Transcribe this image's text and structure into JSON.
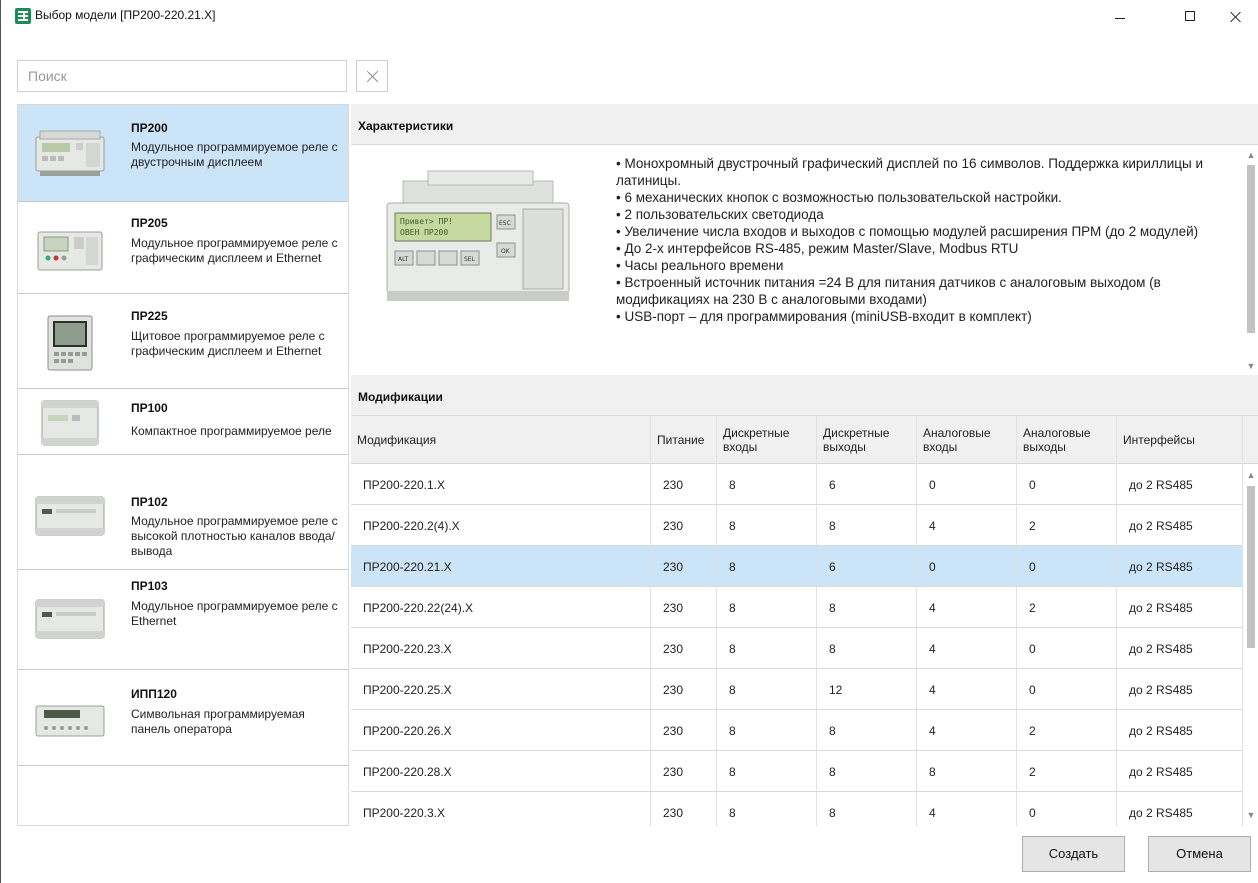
{
  "window": {
    "title": "Выбор модели [ПР200-220.21.X]"
  },
  "search": {
    "placeholder": "Поиск",
    "value": ""
  },
  "models": [
    {
      "name": "ПР200",
      "description": "Модульное программируемое реле с двустрочным дисплеем",
      "selected": true
    },
    {
      "name": "ПР205",
      "description": "Модульное программируемое реле с графическим дисплеем  и Ethernet",
      "selected": false
    },
    {
      "name": "ПР225",
      "description": "Щитовое программируемое реле с графическим дисплеем  и Ethernet",
      "selected": false
    },
    {
      "name": "ПР100",
      "description": "Компактное программируемое реле",
      "selected": false
    },
    {
      "name": "ПР102",
      "description": "Модульное программируемое реле с высокой плотностью каналов ввода/вывода",
      "selected": false
    },
    {
      "name": "ПР103",
      "description": "Модульное программируемое реле с Ethernet",
      "selected": false
    },
    {
      "name": "ИПП120",
      "description": "Символьная программируемая панель оператора",
      "selected": false
    }
  ],
  "characteristics": {
    "header": "Характеристики",
    "lines": [
      "• Монохромный двустрочный графический дисплей по 16 символов. Поддержка кириллицы и латиницы.",
      "• 6 механических кнопок с возможностью пользовательской настройки.",
      "• 2 пользовательских светодиода",
      "• Увеличение числа входов и выходов с помощью модулей расширения ПРМ (до 2 модулей)",
      "• До 2-х интерфейсов RS-485, режим Master/Slave, Modbus RTU",
      "• Часы реального времени",
      "• Встроенный источник питания =24 В для питания датчиков с аналоговым выходом (в модификациях на 230 В с аналоговыми входами)",
      "• USB-порт – для программирования (miniUSB-входит в комплект)"
    ],
    "device_screen_text": [
      "Привет> ПР!",
      "ОВЕН ПР200"
    ],
    "device_buttons": [
      "ALT",
      "SEL",
      "OK",
      "ESC"
    ]
  },
  "modifications": {
    "header": "Модификации",
    "columns": [
      "Модификация",
      "Питание",
      "Дискретные входы",
      "Дискретные выходы",
      "Аналоговые входы",
      "Аналоговые выходы",
      "Интерфейсы"
    ],
    "rows": [
      [
        "ПР200-220.1.X",
        "230",
        "8",
        "6",
        "0",
        "0",
        "до 2 RS485"
      ],
      [
        "ПР200-220.2(4).X",
        "230",
        "8",
        "8",
        "4",
        "2",
        "до 2 RS485"
      ],
      [
        "ПР200-220.21.X",
        "230",
        "8",
        "6",
        "0",
        "0",
        "до 2 RS485"
      ],
      [
        "ПР200-220.22(24).X",
        "230",
        "8",
        "8",
        "4",
        "2",
        "до 2 RS485"
      ],
      [
        "ПР200-220.23.X",
        "230",
        "8",
        "8",
        "4",
        "0",
        "до 2 RS485"
      ],
      [
        "ПР200-220.25.X",
        "230",
        "8",
        "12",
        "4",
        "0",
        "до 2 RS485"
      ],
      [
        "ПР200-220.26.X",
        "230",
        "8",
        "8",
        "4",
        "2",
        "до 2 RS485"
      ],
      [
        "ПР200-220.28.X",
        "230",
        "8",
        "8",
        "8",
        "2",
        "до 2 RS485"
      ],
      [
        "ПР200-220.3.X",
        "230",
        "8",
        "8",
        "4",
        "0",
        "до 2 RS485"
      ]
    ],
    "selected_row": 2
  },
  "buttons": {
    "create": "Создать",
    "cancel": "Отмена"
  },
  "colors": {
    "selection": "#cce4f7",
    "header_bg": "#f0f0f0",
    "app_icon": "#1e8a5a"
  },
  "icons": {
    "app": "app-icon",
    "minimize": "minimize-icon",
    "maximize": "maximize-icon",
    "close": "close-icon",
    "clear": "clear-search-icon"
  }
}
